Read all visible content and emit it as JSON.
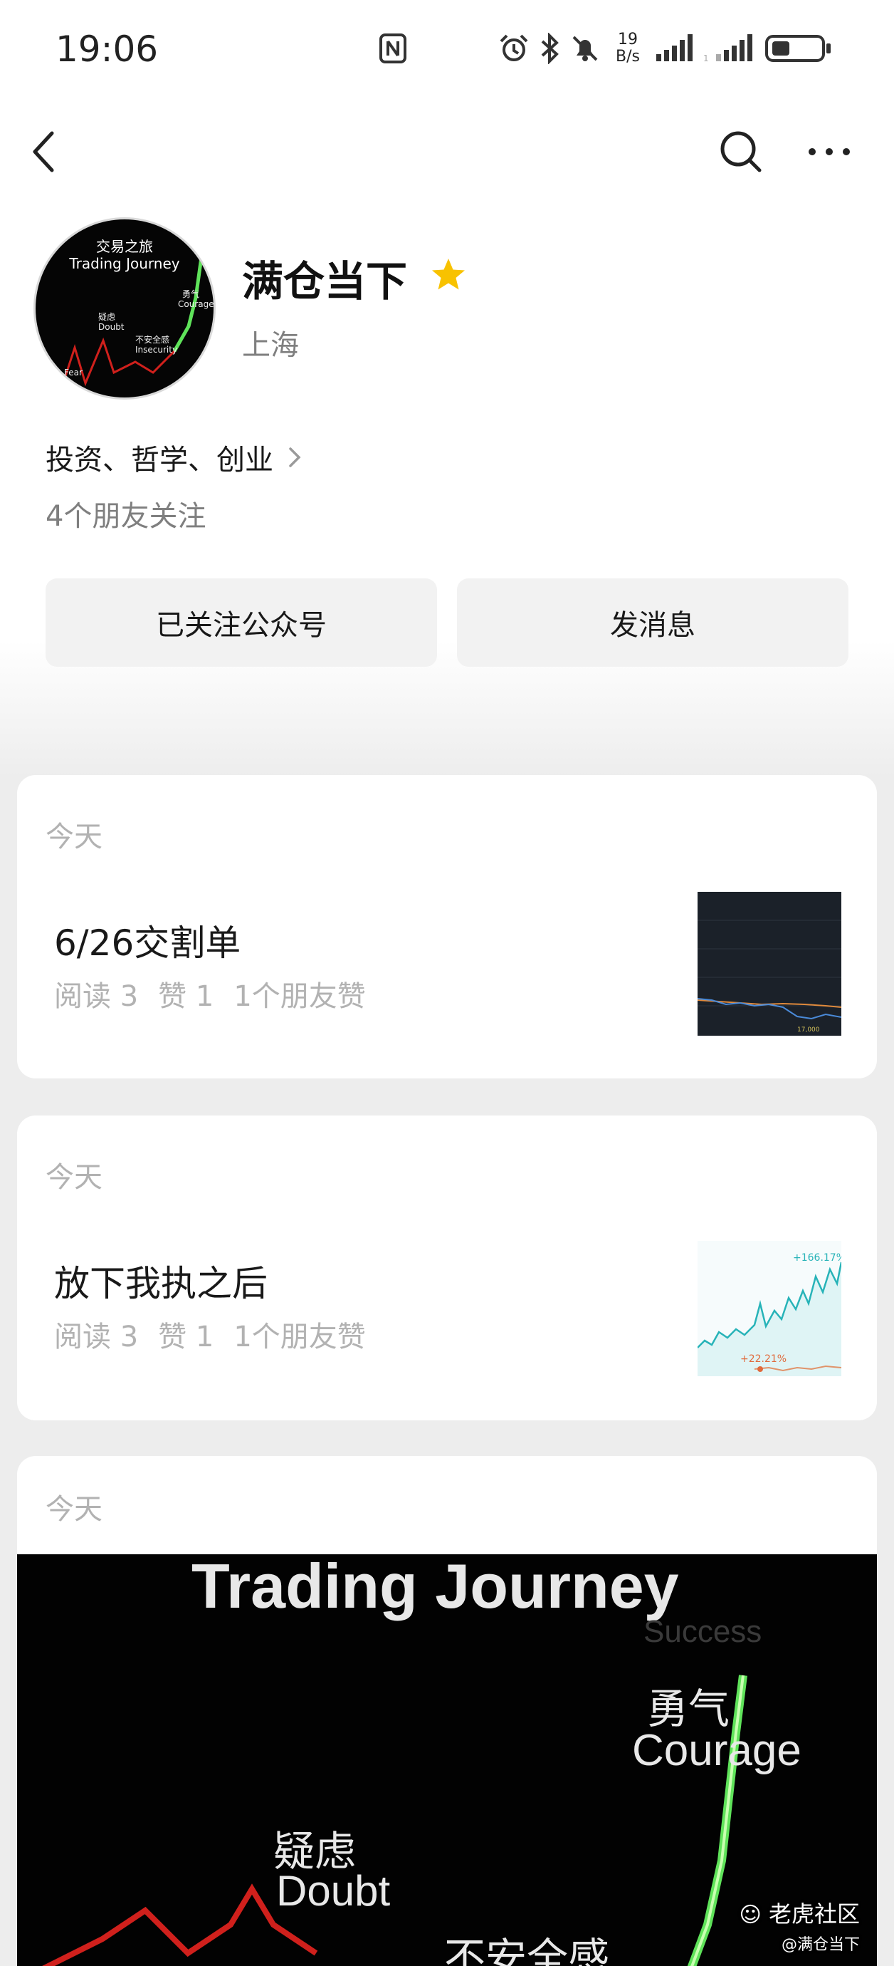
{
  "status_bar": {
    "time": "19:06",
    "net_speed_value": "19",
    "net_speed_unit": "B/s",
    "icons": [
      "nfc-icon",
      "alarm-icon",
      "bluetooth-icon",
      "mute-bell-icon",
      "signal-icon",
      "signal-icon",
      "battery-icon"
    ]
  },
  "nav": {
    "icons": [
      "back-icon",
      "search-icon",
      "more-icon"
    ]
  },
  "profile": {
    "avatar": {
      "cn_title": "交易之旅",
      "en_title": "Trading Journey",
      "label_doubt_cn": "疑虑",
      "label_doubt_en": "Doubt",
      "label_insecurity_cn": "不安全感",
      "label_insecurity_en": "Insecurity",
      "label_courage_cn": "勇气",
      "label_courage_en": "Courage",
      "label_fear": "Fear"
    },
    "name": "满仓当下",
    "location": "上海",
    "tags": "投资、哲学、创业",
    "friends_following": "4个朋友关注",
    "follow_button": "已关注公众号",
    "message_button": "发消息",
    "accent_star": "#f8c200"
  },
  "articles": [
    {
      "date": "今天",
      "title": "6/26交割单",
      "reads": "阅读 3",
      "likes": "赞 1",
      "friend_likes": "1个朋友赞",
      "thumb_label": "17,000"
    },
    {
      "date": "今天",
      "title": "放下我执之后",
      "reads": "阅读 3",
      "likes": "赞 1",
      "friend_likes": "1个朋友赞",
      "thumb_top_label": "+166.17%",
      "thumb_bottom_label": "+22.21%"
    },
    {
      "date": "今天",
      "image": {
        "title": "Trading Journey",
        "faded_word": "Success",
        "courage_cn": "勇气",
        "courage_en": "Courage",
        "doubt_cn": "疑虑",
        "doubt_en": "Doubt",
        "insecurity_cn": "不安全感"
      },
      "watermark_brand": "老虎社区",
      "watermark_user": "@满仓当下"
    }
  ]
}
